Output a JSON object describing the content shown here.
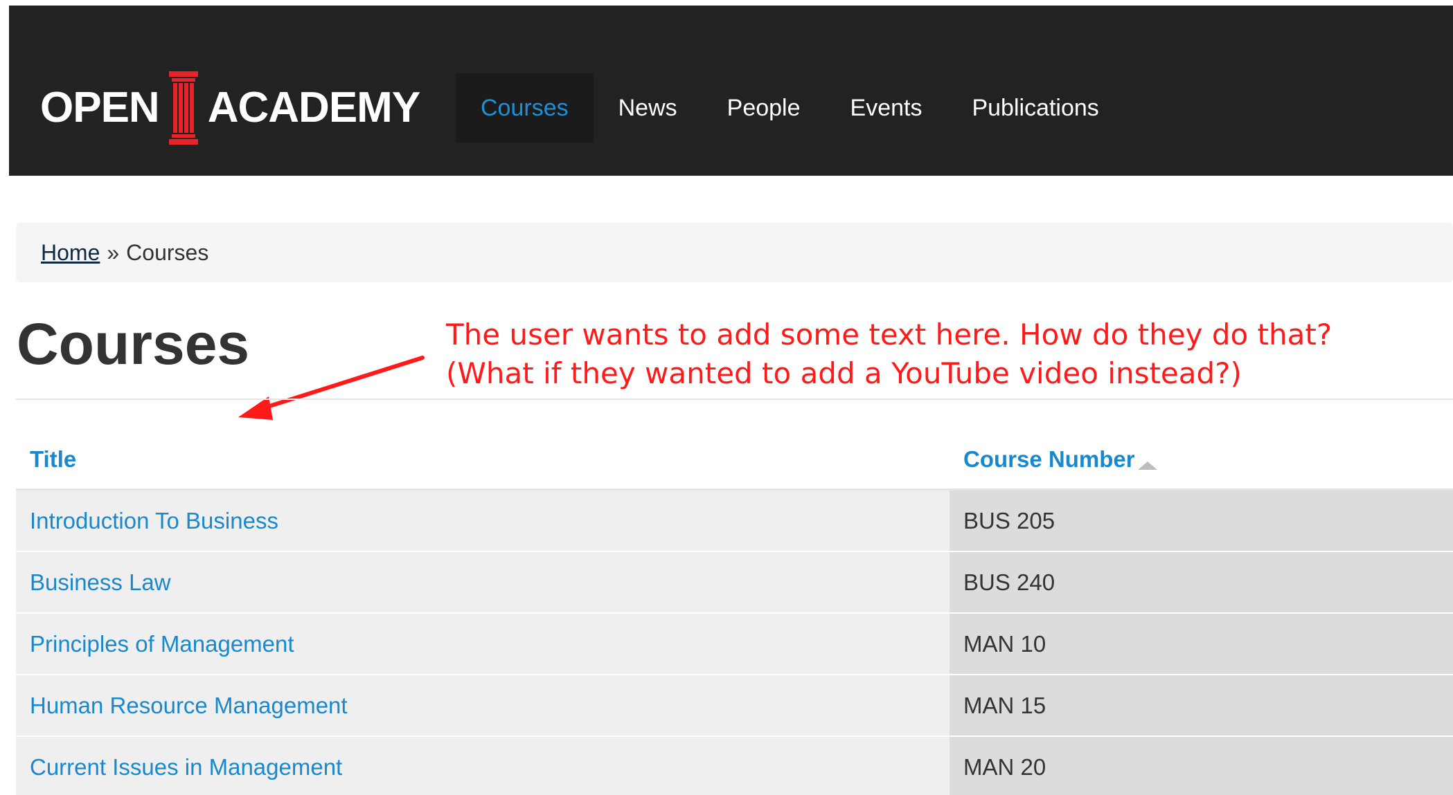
{
  "header": {
    "logo": {
      "word1": "OPEN",
      "word2": "ACADEMY"
    },
    "nav": [
      {
        "label": "Courses",
        "active": true
      },
      {
        "label": "News",
        "active": false
      },
      {
        "label": "People",
        "active": false
      },
      {
        "label": "Events",
        "active": false
      },
      {
        "label": "Publications",
        "active": false
      }
    ]
  },
  "breadcrumb": {
    "home": "Home",
    "separator": "»",
    "current": "Courses"
  },
  "page": {
    "title": "Courses"
  },
  "annotation": {
    "line1": "The user wants to add some text here. How do they do that?",
    "line2": "(What if they wanted to add a YouTube video instead?)"
  },
  "table": {
    "columns": {
      "title": "Title",
      "course_number": "Course Number"
    },
    "sort": {
      "column": "course_number",
      "direction": "ascending"
    },
    "rows": [
      {
        "title": "Introduction To Business",
        "course_number": "BUS 205"
      },
      {
        "title": "Business Law",
        "course_number": "BUS 240"
      },
      {
        "title": "Principles of Management",
        "course_number": "MAN 10"
      },
      {
        "title": "Human Resource Management",
        "course_number": "MAN 15"
      },
      {
        "title": "Current Issues in Management",
        "course_number": "MAN 20"
      }
    ]
  },
  "colors": {
    "navbar": "#222222",
    "link": "#1a88cc",
    "annotation": "#ff1a1a",
    "logo_pillar": "#e8232a"
  }
}
